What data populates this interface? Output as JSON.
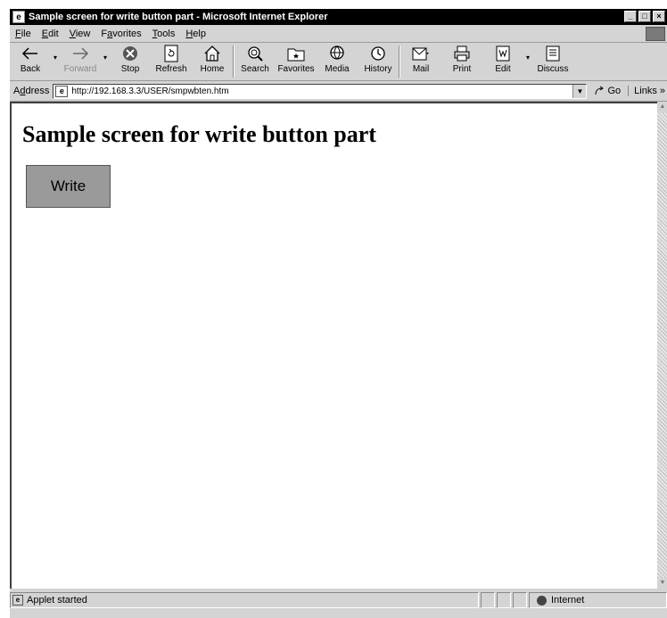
{
  "window": {
    "title": "Sample screen for write button part - Microsoft Internet Explorer",
    "title_icon_glyph": "e",
    "controls": {
      "minimize": "_",
      "maximize": "□",
      "close": "×"
    }
  },
  "menu": {
    "items": [
      {
        "underline": "F",
        "rest": "ile"
      },
      {
        "underline": "E",
        "rest": "dit"
      },
      {
        "underline": "V",
        "rest": "iew"
      },
      {
        "before": "F",
        "underline": "a",
        "rest": "vorites"
      },
      {
        "underline": "T",
        "rest": "ools"
      },
      {
        "underline": "H",
        "rest": "elp"
      }
    ]
  },
  "toolbar": {
    "back": "Back",
    "forward": "Forward",
    "stop": "Stop",
    "refresh": "Refresh",
    "home": "Home",
    "search": "Search",
    "favorites": "Favorites",
    "media": "Media",
    "history": "History",
    "mail": "Mail",
    "print": "Print",
    "edit": "Edit",
    "discuss": "Discuss"
  },
  "address": {
    "label_before": "A",
    "label_underline": "d",
    "label_after": "dress",
    "url": "http://192.168.3.3/USER/smpwbten.htm",
    "go": "Go",
    "links": "Links »"
  },
  "page": {
    "heading": "Sample screen for write button part",
    "write_button": "Write"
  },
  "status": {
    "text": "Applet started",
    "zone": "Internet"
  }
}
